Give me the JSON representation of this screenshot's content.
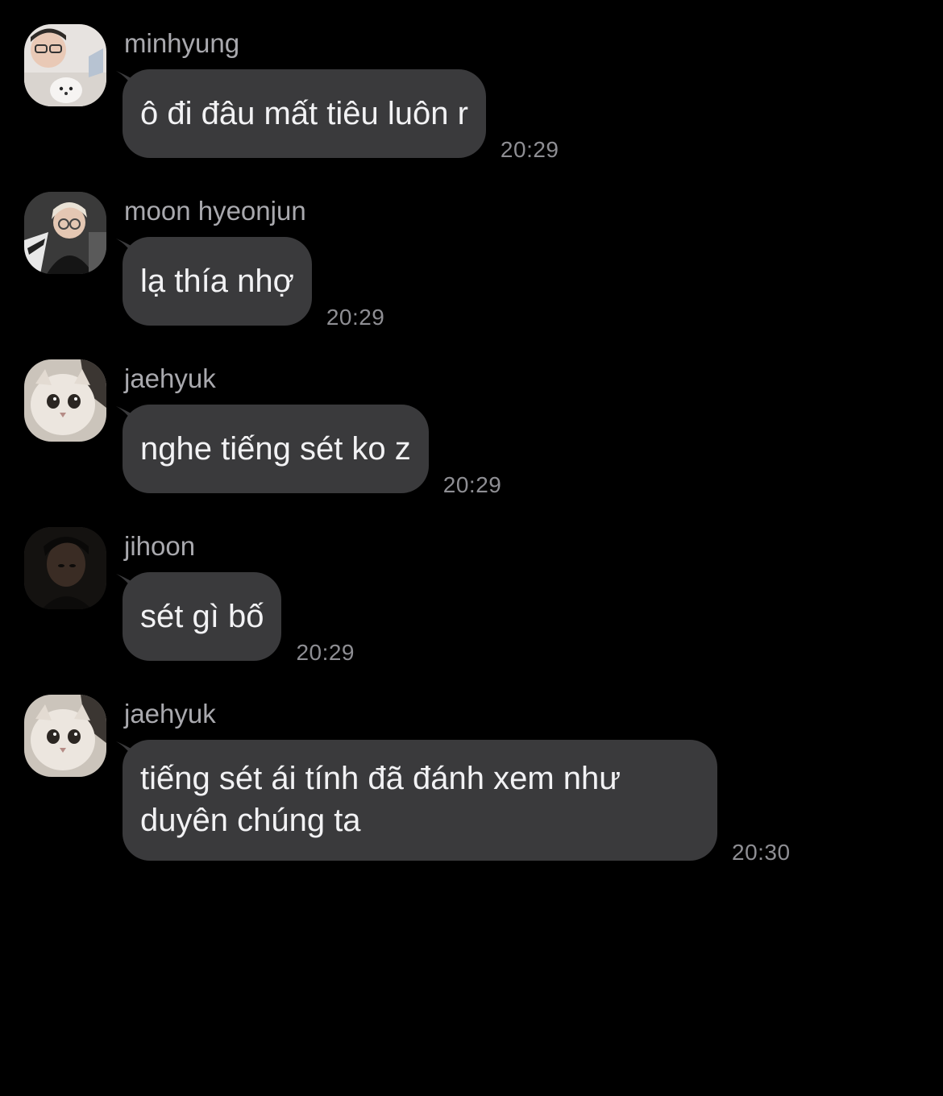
{
  "messages": [
    {
      "sender": "minhyung",
      "text": "ô đi đâu mất tiêu luôn r",
      "time": "20:29",
      "avatar": "avatar-minhyung"
    },
    {
      "sender": "moon hyeonjun",
      "text": "lạ thía nhợ",
      "time": "20:29",
      "avatar": "avatar-moon-hyeonjun"
    },
    {
      "sender": "jaehyuk",
      "text": "nghe tiếng sét ko z",
      "time": "20:29",
      "avatar": "avatar-jaehyuk"
    },
    {
      "sender": "jihoon",
      "text": "sét gì bố",
      "time": "20:29",
      "avatar": "avatar-jihoon"
    },
    {
      "sender": "jaehyuk",
      "text": "tiếng sét ái tính đã đánh xem như duyên chúng ta",
      "time": "20:30",
      "avatar": "avatar-jaehyuk"
    }
  ],
  "colors": {
    "background": "#000000",
    "bubble": "#3a3a3c",
    "bubble_text": "#f2f2f4",
    "sender_text": "#a9a9ae",
    "time_text": "#8e8e93"
  }
}
